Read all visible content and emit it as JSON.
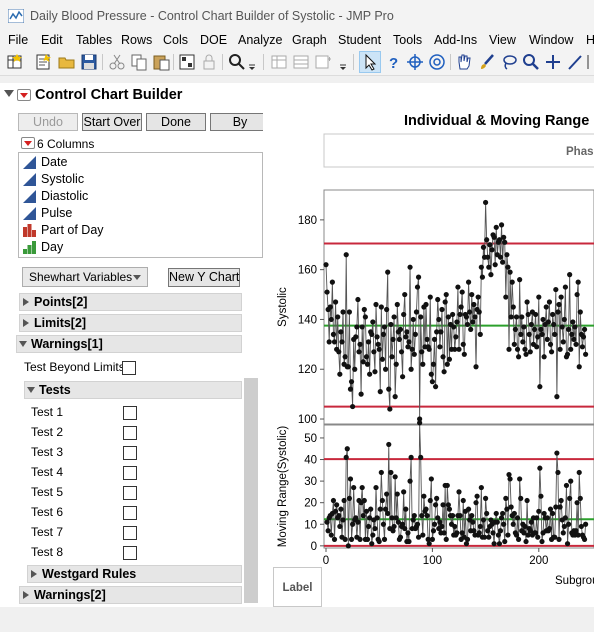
{
  "window": {
    "title": "Daily Blood Pressure - Control Chart Builder of Systolic - JMP Pro"
  },
  "menu": [
    "File",
    "Edit",
    "Tables",
    "Rows",
    "Cols",
    "DOE",
    "Analyze",
    "Graph",
    "Student",
    "Tools",
    "Add-Ins",
    "View",
    "Window",
    "H"
  ],
  "toolbar_icons": [
    "new-data-table-icon",
    "new-script-icon",
    "open-icon",
    "save-icon",
    "cut-icon",
    "copy-icon",
    "paste-icon",
    "report-icon",
    "lock-icon",
    "search-icon",
    "overflow-icon",
    "table-a-icon",
    "table-b-icon",
    "table-c-icon",
    "overflow-icon",
    "arrow-tool-icon",
    "help-tool-icon",
    "crosshair-tool-icon",
    "brush-tool-icon",
    "hand-tool-icon",
    "lasso-tool-icon",
    "magnifier-tool-icon",
    "plus-tool-icon",
    "line-tool-icon"
  ],
  "builder": {
    "title": "Control Chart Builder",
    "buttons": {
      "undo": "Undo",
      "start_over": "Start Over",
      "done": "Done",
      "by": "By"
    },
    "columns_header": "6 Columns",
    "columns": [
      {
        "name": "Date",
        "icon": "continuous-icon",
        "color": "#2f5597"
      },
      {
        "name": "Systolic",
        "icon": "continuous-icon",
        "color": "#2f5597"
      },
      {
        "name": "Diastolic",
        "icon": "continuous-icon",
        "color": "#2f5597"
      },
      {
        "name": "Pulse",
        "icon": "continuous-icon",
        "color": "#2f5597"
      },
      {
        "name": "Part of Day",
        "icon": "nominal-icon",
        "color": "#c0392b"
      },
      {
        "name": "Day",
        "icon": "ordinal-icon",
        "color": "#3a9a3a"
      }
    ],
    "chart_type": "Shewhart Variables",
    "new_y_chart": "New Y Chart",
    "sections": {
      "points": "Points[2]",
      "limits": "Limits[2]",
      "warnings1": "Warnings[1]",
      "test_beyond": "Test Beyond Limits",
      "tests": "Tests",
      "westgard": "Westgard Rules",
      "warnings2": "Warnings[2]"
    },
    "tests": [
      "Test 1",
      "Test 2",
      "Test 3",
      "Test 4",
      "Test 5",
      "Test 6",
      "Test 7",
      "Test 8"
    ]
  },
  "chart_header": {
    "title": "Individual & Moving Range",
    "phase": "Phase",
    "label_zone": "Label",
    "x_title": "Subgrou"
  },
  "colors": {
    "limit": "#c8283c",
    "center": "#2ca02c",
    "points": "#111111",
    "line": "#555555"
  },
  "chart_data": [
    {
      "type": "line",
      "ylabel": "Systolic",
      "ylim": [
        98,
        192
      ],
      "yticks": [
        100,
        120,
        140,
        160,
        180
      ],
      "center": 137.5,
      "ucl": 170.5,
      "lcl": 105,
      "xlim": [
        0,
        250
      ],
      "xticks": [
        0,
        100,
        200
      ],
      "values": [
        162,
        151,
        144,
        131,
        145,
        140,
        155,
        134,
        131,
        147,
        128,
        141,
        127,
        118,
        135,
        131,
        143,
        122,
        125,
        166,
        121,
        121,
        143,
        112,
        115,
        105,
        132,
        120,
        133,
        137,
        148,
        127,
        130,
        110,
        137,
        123,
        144,
        141,
        125,
        122,
        131,
        118,
        135,
        134,
        139,
        127,
        119,
        146,
        133,
        130,
        128,
        111,
        145,
        124,
        134,
        137,
        120,
        144,
        159,
        112,
        104,
        138,
        125,
        132,
        141,
        109,
        122,
        146,
        135,
        132,
        136,
        127,
        117,
        142,
        150,
        133,
        135,
        129,
        131,
        161,
        120,
        128,
        140,
        126,
        134,
        143,
        153,
        157,
        100,
        141,
        127,
        122,
        145,
        129,
        146,
        132,
        129,
        128,
        149,
        118,
        115,
        122,
        132,
        113,
        135,
        148,
        140,
        129,
        135,
        144,
        125,
        119,
        147,
        150,
        122,
        141,
        124,
        138,
        128,
        142,
        137,
        128,
        133,
        139,
        153,
        128,
        142,
        145,
        151,
        130,
        126,
        142,
        141,
        138,
        155,
        143,
        136,
        150,
        139,
        146,
        141,
        121,
        144,
        149,
        143,
        134,
        161,
        157,
        169,
        165,
        187,
        172,
        165,
        161,
        170,
        158,
        168,
        174,
        173,
        162,
        177,
        166,
        171,
        172,
        165,
        178,
        163,
        173,
        171,
        149,
        166,
        161,
        128,
        159,
        141,
        155,
        145,
        130,
        136,
        141,
        128,
        125,
        156,
        134,
        141,
        131,
        137,
        128,
        126,
        147,
        142,
        134,
        127,
        138,
        143,
        130,
        136,
        142,
        129,
        133,
        149,
        113,
        136,
        134,
        140,
        125,
        138,
        145,
        132,
        139,
        147,
        130,
        127,
        142,
        138,
        134,
        152,
        109,
        143,
        146,
        128,
        149,
        137,
        131,
        140,
        153,
        125,
        126,
        136,
        158,
        128,
        134,
        139,
        132,
        137,
        130,
        150,
        155,
        121,
        143,
        134,
        129,
        133,
        136,
        126
      ]
    },
    {
      "type": "line",
      "ylabel": "Moving Range(Systolic)",
      "ylim": [
        -1,
        56
      ],
      "yticks": [
        0,
        10,
        20,
        30,
        40,
        50
      ],
      "center": 12.3,
      "ucl": 40.2,
      "lcl": 0,
      "xlim": [
        0,
        250
      ],
      "values": []
    }
  ]
}
